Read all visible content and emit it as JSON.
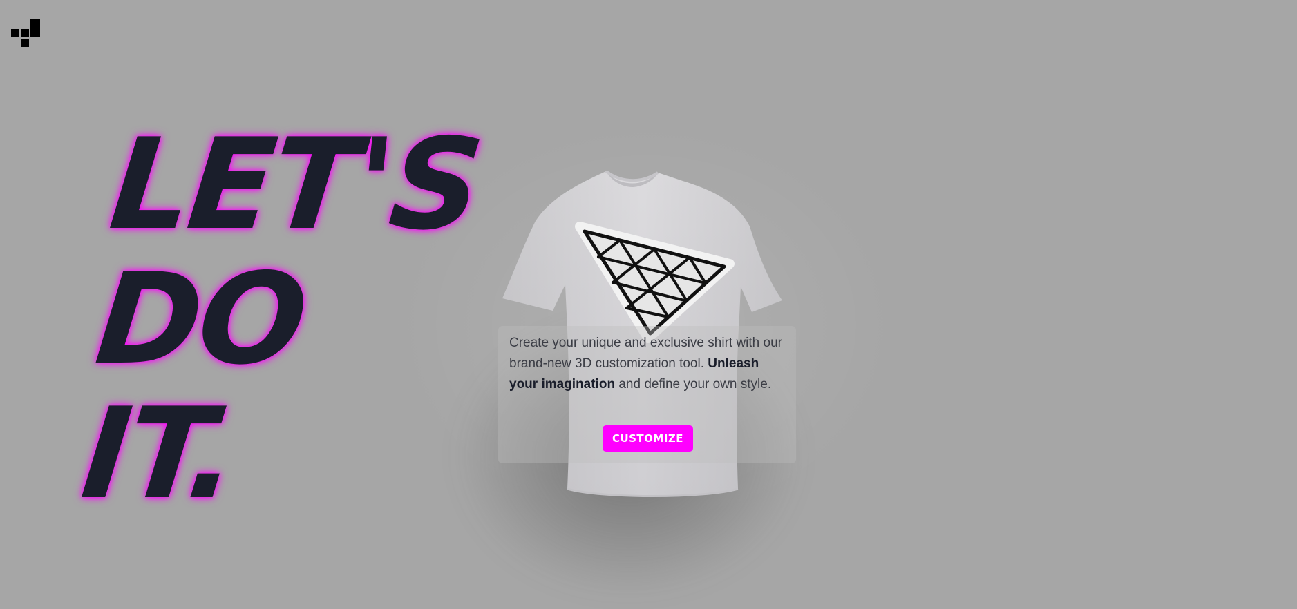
{
  "brand": {
    "logo_icon": "pixel-blocks-logo-icon"
  },
  "hero": {
    "headline_lines": [
      "LET'S",
      "DO",
      "IT."
    ],
    "description_part1": "Create your unique and exclusive shirt with our brand-new 3D customization tool. ",
    "description_emphasis": "Unleash your imagination",
    "description_part2": " and define your own style.",
    "cta_label": "CUSTOMIZE"
  },
  "model": {
    "icon": "tshirt-3d-model",
    "decal_icon": "triangle-grid-decal-icon"
  },
  "colors": {
    "background": "#a6a6a6",
    "accent": "#ff00ff",
    "headline": "#1a1e2b",
    "shirt": "#d6d5d8"
  }
}
